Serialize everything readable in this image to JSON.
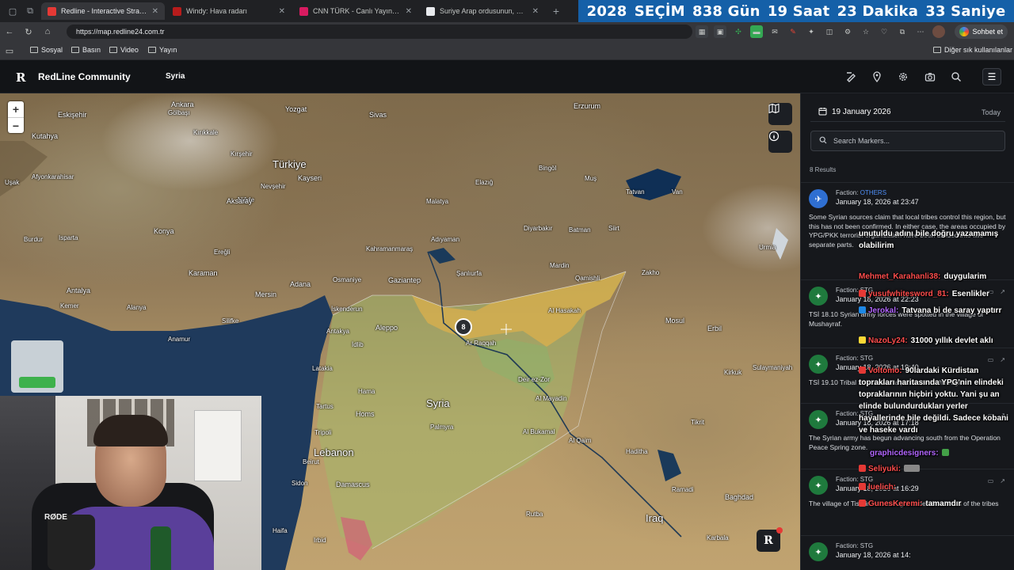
{
  "browser": {
    "tabs": [
      {
        "title": "Redline - Interactive Strategic Map",
        "active": true,
        "color": "#e53935"
      },
      {
        "title": "Windy: Hava radarı",
        "active": false,
        "color": "#b71c1c"
      },
      {
        "title": "CNN TÜRK - Canlı Yayın ᴴᴰ - C",
        "active": false,
        "color": "#d81b60"
      },
      {
        "title": "Suriye Arap ordusunun, Haseke şe",
        "active": false,
        "color": "#e8eaed"
      }
    ],
    "url": "https://map.redline24.com.tr",
    "chat_button": "Sohbet et",
    "bookmarks": [
      "Sosyal",
      "Basın",
      "Video",
      "Yayın"
    ],
    "other_bookmarks": "Diğer sık kullanılanlar",
    "new_tab_symbol": "+"
  },
  "countdown": {
    "year": "2028",
    "label": "SEÇİM",
    "days": "838 Gün",
    "hours": "19 Saat",
    "minutes": "23 Dakika",
    "seconds": "33 Saniye"
  },
  "app": {
    "logo": "R",
    "brand": "RedLine Community",
    "region": "Syria",
    "header_icons": [
      "bookmark-draw-icon",
      "location-pin-icon",
      "gear-icon",
      "camera-icon",
      "search-icon",
      "menu-icon"
    ]
  },
  "map": {
    "zoom_in": "+",
    "zoom_out": "−",
    "cluster_count": "8",
    "badge": "R",
    "labels": {
      "turkiye": "Türkiye",
      "syria": "Syria",
      "lebanon": "Lebanon",
      "iraq": "Iraq",
      "ankara": "Ankara",
      "eskisehir": "Eskişehir",
      "kutahya": "Kutahya",
      "konya": "Konya",
      "kayseri": "Kayseri",
      "yozgat": "Yozgat",
      "sivas": "Sivas",
      "erzurum": "Erzurum",
      "aksaray": "Aksaray",
      "karaman": "Karaman",
      "antalya": "Antalya",
      "mersin": "Mersin",
      "adana": "Adana",
      "osmaniye": "Osmaniye",
      "gaziantep": "Gaziantep",
      "kahramanmaras": "Kahramanmaraş",
      "malatya": "Malatya",
      "elazig": "Elazığ",
      "mus": "Muş",
      "tatvan": "Tatvan",
      "van": "Van",
      "bingol": "Bingöl",
      "diyarbakir": "Diyarbakır",
      "batman": "Batman",
      "siirt": "Siirt",
      "mardin": "Mardin",
      "sanliurfa": "Şanlıurfa",
      "adiyaman": "Adıyaman",
      "aleppo": "Aleppo",
      "iskenderun": "İskenderun",
      "antakya": "Antakya",
      "idlib": "İdlib",
      "latakia": "Latakia",
      "tartus": "Tartus",
      "hama": "Hama",
      "homs": "Homs",
      "tripoli": "Tripoli",
      "beirut": "Beirut",
      "damascus": "Damascus",
      "sidon": "Sidon",
      "haifa": "Haifa",
      "irbid": "Irbid",
      "palmyra": "Palmyra",
      "arraqqa": "Ar Raqqah",
      "deirezzor": "Deir ez-Zor",
      "almayadin": "Al Mayadin",
      "albukamal": "Al Bukamal",
      "alhasakah": "Al Hasakah",
      "qamishli": "Qamishli",
      "zakho": "Zakho",
      "mosul": "Mosul",
      "erbil": "Erbil",
      "kirkuk": "Kirkuk",
      "sulaymaniyah": "Sulaymaniyah",
      "tikrit": "Tikrit",
      "baghdad": "Baghdad",
      "karbala": "Karbala",
      "ramadi": "Ramadi",
      "rutba": "Rutba",
      "haditha": "Haditha",
      "qaim": "Al Qaim",
      "urmia": "Urmia",
      "kermanshah": "Kermanshah",
      "alanya": "Alanya",
      "silifke": "Silifke",
      "anamur": "Anamur",
      "isparta": "Isparta",
      "burdur": "Burdur",
      "usak": "Uşak",
      "nigde": "Niğde",
      "eregli": "Ereğli",
      "kirsehir": "Kırşehir",
      "nevsehir": "Nevşehir",
      "afyon": "Afyonkarahisar",
      "kemer": "Kemer",
      "kirikkale": "Kırıkkale",
      "golbasi": "Gölbaşı"
    }
  },
  "panel": {
    "date": "19 January 2026",
    "today": "Today",
    "search_placeholder": "Search Markers...",
    "results": "8 Results",
    "entries": [
      {
        "faction": "Faction:",
        "faction_name": "OTHERS",
        "faction_color": "#4f8ff7",
        "date": "January 18, 2026 at 23:47",
        "text": "Some Syrian sources claim that local tribes control this region, but this has not been confirmed. In either case, the areas occupied by YPG/PKK terrorist organization have been divided into two separate parts."
      },
      {
        "faction": "Faction:",
        "faction_name": "STG",
        "faction_color": "#9aa0a6",
        "date": "January 18, 2026 at 22:23",
        "text": "TSİ 18.10 Syrian army forces were spotted in the village of Mushayraf."
      },
      {
        "faction": "Faction:",
        "faction_name": "STG",
        "faction_color": "#9aa0a6",
        "date": "January 18, 2026 at 19:40",
        "text": "TSİ 19.10 Tribal forces have a presence in the region."
      },
      {
        "faction": "Faction:",
        "faction_name": "STG",
        "faction_color": "#9aa0a6",
        "date": "January 18, 2026 at 17:18",
        "text": "The Syrian army has begun advancing south from the Operation Peace Spring zone."
      },
      {
        "faction": "Faction:",
        "faction_name": "STG",
        "faction_color": "#9aa0a6",
        "date": "January 18, 2026 at 16:29",
        "text": "The village of Tishrin was brought under the control of the tribes"
      },
      {
        "faction": "Faction:",
        "faction_name": "STG",
        "faction_color": "#9aa0a6",
        "date": "January 18, 2026 at 14:",
        "text": ""
      }
    ]
  },
  "chat": [
    {
      "user": "",
      "text": "unutuldu adını bile doğru yazamamış olabilirim",
      "color": "#ffffff"
    },
    {
      "user": "Mehmet_Karahanli38:",
      "text": "duygularim",
      "color": "#ff4d4d"
    },
    {
      "user": "yusufwhitesword_81:",
      "text": "Esenlikler",
      "color": "#ff4d4d"
    },
    {
      "user": "Jerokal:",
      "text": "Tatvana bi de saray yaptırr",
      "color": "#b266ff"
    },
    {
      "user": "NazoLy24:",
      "text": "31000 yıllık devlet aklı",
      "color": "#ff4d4d"
    },
    {
      "user": "Voltomo:",
      "text": "90lardaki Kürdistan toprakları haritasında YPG'nin elindeki topraklarının hiçbiri yoktu. Yani şu an elinde bulundurdukları yerler hayallerinde bile değildi. Sadece kobani ve haseke vardı",
      "color": "#ff4d4d"
    },
    {
      "user": "graphicdesigners:",
      "text": "",
      "color": "#b266ff"
    },
    {
      "user": "Seliyuki:",
      "text": "",
      "color": "#ff4d4d"
    },
    {
      "user": "luelich:",
      "text": "",
      "color": "#ff4d4d"
    },
    {
      "user": "GunesKeremi:",
      "text": "tamamdır",
      "color": "#ff4d4d"
    }
  ],
  "webcam": {
    "mic_brand": "RØDE"
  }
}
